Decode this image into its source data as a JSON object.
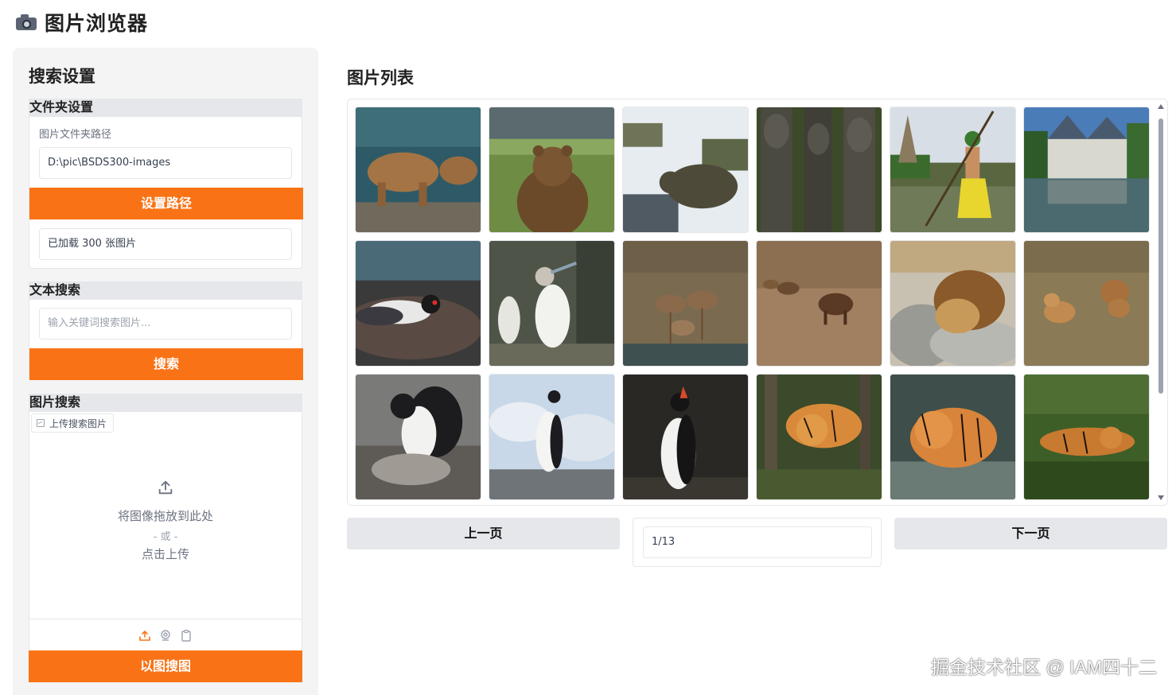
{
  "app": {
    "title": "图片浏览器",
    "icon": "camera-icon"
  },
  "sidebar": {
    "title": "搜索设置",
    "folder": {
      "label": "文件夹设置",
      "path_label": "图片文件夹路径",
      "path_value": "D:\\pic\\BSDS300-images",
      "set_button": "设置路径",
      "status": "已加载 300 张图片"
    },
    "text_search": {
      "label": "文本搜索",
      "placeholder": "输入关键词搜索图片...",
      "button": "搜索"
    },
    "image_search": {
      "label": "图片搜索",
      "tab_label": "上传搜索图片",
      "drop_text": "将图像拖放到此处",
      "or_text": "- 或 -",
      "click_text": "点击上传",
      "button": "以图搜图"
    },
    "accent_color": "#f97316"
  },
  "main": {
    "title": "图片列表",
    "images": [
      {
        "subject": "brown bears in water"
      },
      {
        "subject": "brown bear in grass"
      },
      {
        "subject": "bear in snow"
      },
      {
        "subject": "wooden totem carvings"
      },
      {
        "subject": "woman with spear in water"
      },
      {
        "subject": "chateau reflected in water"
      },
      {
        "subject": "gull on rocks"
      },
      {
        "subject": "booby bird"
      },
      {
        "subject": "deer herd"
      },
      {
        "subject": "lions in savanna"
      },
      {
        "subject": "sleeping lion"
      },
      {
        "subject": "lionesses in grass"
      },
      {
        "subject": "penguin with chick"
      },
      {
        "subject": "penguin on ice"
      },
      {
        "subject": "penguin on dark background"
      },
      {
        "subject": "tiger in forest"
      },
      {
        "subject": "tiger in water"
      },
      {
        "subject": "tiger lying in grass"
      }
    ],
    "prev_button": "上一页",
    "page_indicator": "1/13",
    "next_button": "下一页"
  },
  "watermark": "掘金技术社区 @ IAM四十二"
}
